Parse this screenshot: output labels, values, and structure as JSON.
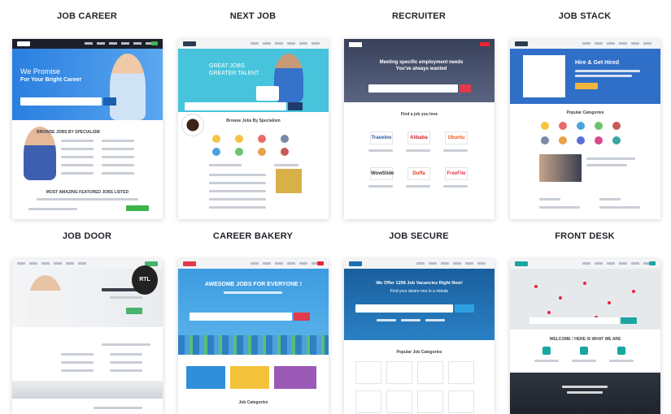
{
  "templates": [
    {
      "id": "job-career",
      "title": "JOB CAREER",
      "hero_line1": "We Promise",
      "hero_line2": "For Your Bright Career",
      "section": "BROWSE JOBS BY SPECIALISM",
      "footer": "MOST AMAZING FEATURED JOBS LISTED",
      "accent": "#2d7fe3"
    },
    {
      "id": "next-job",
      "title": "NEXT JOB",
      "hero_line1": "GREAT JOBS.",
      "hero_line2": "GREATER TALENT.",
      "section": "Browse Jobs By Specialism",
      "accent": "#47c4dc"
    },
    {
      "id": "recruiter",
      "title": "RECRUITER",
      "hero_line1": "Meeting specific employment needs",
      "hero_line2": "You've always wanted",
      "section": "Find a job you love",
      "accent": "#46506a"
    },
    {
      "id": "job-stack",
      "title": "JOB STACK",
      "hero_line1": "Hire & Get Hired",
      "section": "Popular Categories",
      "accent": "#2f6fc7"
    },
    {
      "id": "job-door",
      "title": "JOB DOOR",
      "rtl_label": "RTL",
      "accent": "#49b26b"
    },
    {
      "id": "career-bakery",
      "title": "CAREER BAKERY",
      "hero_line1": "AWESOME JOBS FOR EVERYONE !",
      "section": "Job Categories",
      "accent": "#2f8fd8"
    },
    {
      "id": "job-secure",
      "title": "JOB SECURE",
      "hero_line1": "We Offer 1258 Job Vacancies Right Now!",
      "hero_line2": "Find your desire one in a minute",
      "section": "Popular Job Categories",
      "accent": "#1e6fb5"
    },
    {
      "id": "front-desk",
      "title": "FRONT DESK",
      "section": "WELCOME ! HERE IS WHAT WE ARE",
      "accent": "#1aa6a0"
    }
  ],
  "logos": {
    "recruiter": [
      "Traveloo",
      "Alibaba",
      "Ubuntu",
      "WowSlide",
      "Duffa",
      "FreeFile"
    ]
  }
}
